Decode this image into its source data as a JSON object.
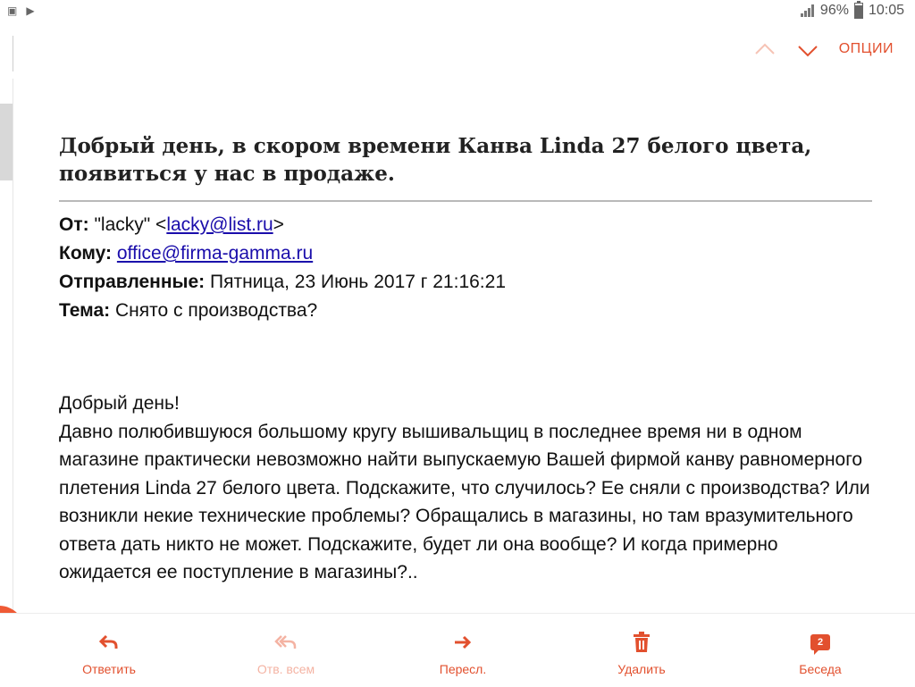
{
  "status": {
    "battery": "96%",
    "time": "10:05"
  },
  "toolbar": {
    "options_label": "ОПЦИИ"
  },
  "email": {
    "subject": "Добрый день, в скором времени Канва Linda 27 белого цвета, появиться у нас в продаже.",
    "from_label": "От:",
    "from_name": "\"lacky\" <",
    "from_email": "lacky@list.ru",
    "from_close": ">",
    "to_label": "Кому:",
    "to_email": "office@firma-gamma.ru",
    "sent_label": "Отправленные:",
    "sent_value": "Пятница, 23 Июнь 2017 г 21:16:21",
    "topic_label": "Тема:",
    "topic_value": "Снято с производства?",
    "body": [
      "Добрый день!",
      "Давно полюбившуюся большому кругу вышивальщиц в последнее время ни в одном магазине практически невозможно найти выпускаемую Вашей фирмой канву равномерного плетения Linda 27 белого цвета. Подскажите, что случилось? Ее сняли с производства? Или возникли некие технические проблемы? Обращались в магазины, но там вразумительного ответа дать никто не может. Подскажите, будет ли она вообще? И когда примерно ожидается ее поступление в магазины?.."
    ]
  },
  "bottom": {
    "reply": "Ответить",
    "reply_all": "Отв. всем",
    "forward": "Пересл.",
    "delete": "Удалить",
    "conversation": "Беседа",
    "conversation_count": "2"
  },
  "colors": {
    "accent": "#e2502e",
    "link": "#1a0dab"
  }
}
